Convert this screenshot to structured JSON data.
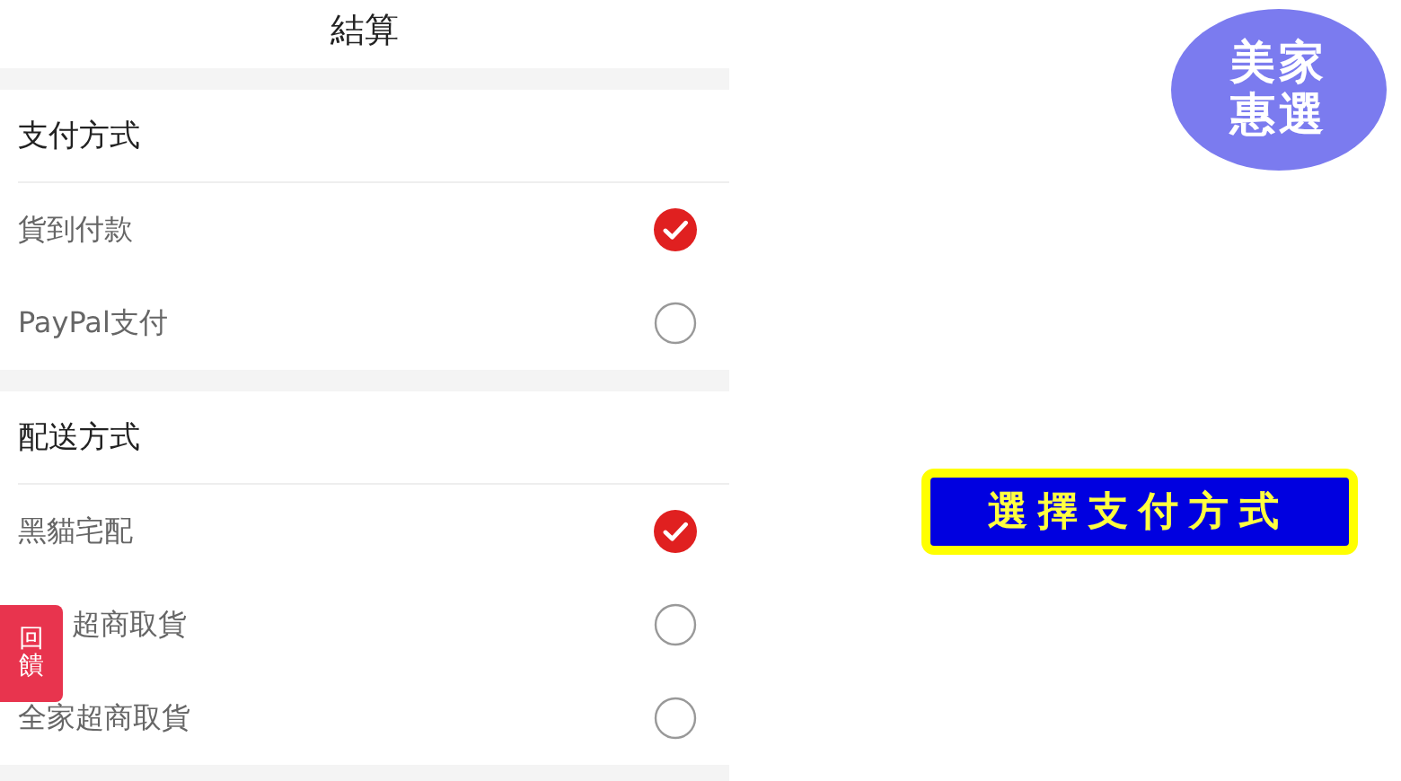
{
  "header": {
    "title": "結算"
  },
  "sections": [
    {
      "title": "支付方式",
      "options": [
        {
          "label": "貨到付款",
          "selected": true
        },
        {
          "label": "PayPal支付",
          "selected": false
        }
      ]
    },
    {
      "title": "配送方式",
      "options": [
        {
          "label": "黑貓宅配",
          "selected": true
        },
        {
          "label": "超商取貨",
          "selected": false,
          "covered": true
        },
        {
          "label": "全家超商取貨",
          "selected": false
        }
      ]
    }
  ],
  "feedback_tab": {
    "label": "回饋"
  },
  "logo": {
    "lines": [
      "美家",
      "惠選"
    ]
  },
  "banner": {
    "text": "選擇支付方式"
  }
}
